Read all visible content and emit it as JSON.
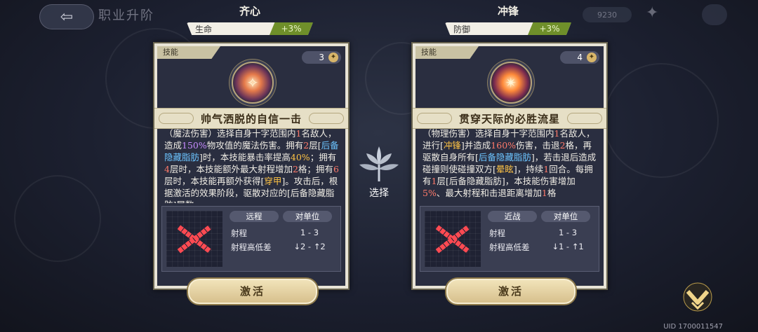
{
  "topbar": {
    "back_glyph": "⇦",
    "title": "职业升阶",
    "currency": "9230",
    "icon_name": "spark-icon"
  },
  "cards": [
    {
      "name": "齐心",
      "stat_label": "生命",
      "stat_value": "+3%",
      "tag": "技能",
      "cost": "3",
      "skill_title": "帅气洒脱的自信一击",
      "desc_html": "（魔法伤害）选择自身十字范围内<span class='hl-red'>1</span>名敌人，造成<span class='hl-purple'>150%</span>物攻值的魔法伤害。拥有<span class='hl-red'>2</span>层[<span class='hl-blue'>后备隐藏脂肪</span>]时，本技能暴击率提高<span class='hl-yellow'>40%</span>；拥有<span class='hl-red'>4</span>层时，本技能额外最大射程增加<span class='hl-red'>2</span>格；拥有<span class='hl-red'>6</span>层时，本技能再额外获得[<span class='hl-yellow'>穿甲</span>]。攻击后，根据激活的效果阶段，驱散对应的[后备隐藏脂肪]层数",
      "range_type": "远程",
      "target_type": "对单位",
      "range_label": "射程",
      "range_value": "1 - 3",
      "height_label": "射程高低差",
      "height_value": "↓2 - ↑2",
      "button": "激活"
    },
    {
      "name": "冲锋",
      "stat_label": "防御",
      "stat_value": "+3%",
      "tag": "技能",
      "cost": "4",
      "skill_title": "贯穿天际的必胜流星",
      "desc_html": "（物理伤害）选择自身十字范围内<span class='hl-red'>1</span>名敌人，进行[<span class='hl-yellow'>冲锋</span>]并造成<span class='hl-red'>160%</span>伤害，击退<span class='hl-red'>2</span>格，再驱散自身所有[<span class='hl-blue'>后备隐藏脂肪</span>]，若击退后造成碰撞则使碰撞双方[<span class='hl-yellow'>晕眩</span>]，持续<span class='hl-red'>1</span>回合。每拥有<span class='hl-red'>1</span>层[后备隐藏脂肪]，本技能伤害增加<span class='hl-red'>5%</span>、最大射程和击退距离增加<span class='hl-red'>1</span>格",
      "range_type": "近战",
      "target_type": "对单位",
      "range_label": "射程",
      "range_value": "1 - 3",
      "height_label": "射程高低差",
      "height_value": "↓1 - ↑1",
      "button": "激活"
    }
  ],
  "choose_label": "选择",
  "uid": "UID 1700011547",
  "colors": {
    "accent_green": "#6f8f2a",
    "range_red": "#ff4a52",
    "button_gold": "#d7c08d"
  }
}
